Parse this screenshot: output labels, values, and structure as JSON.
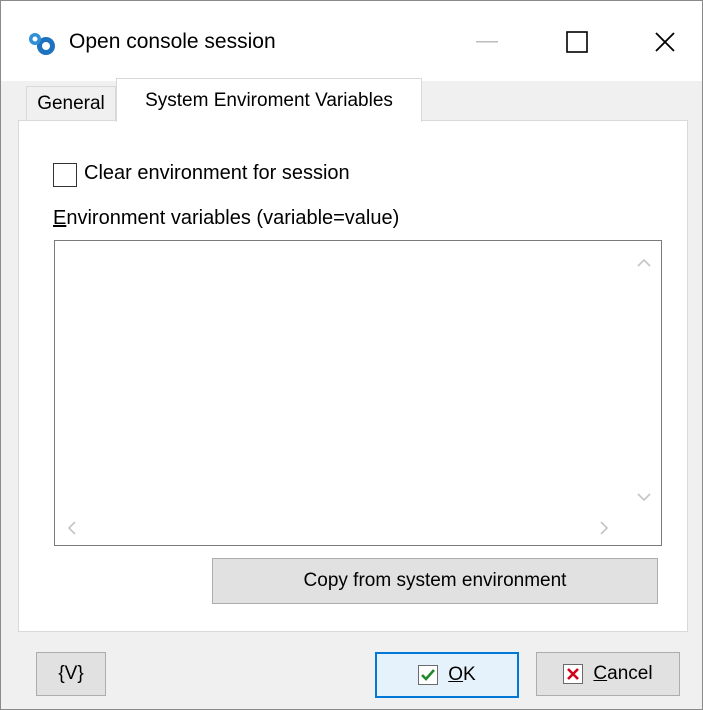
{
  "window": {
    "title": "Open console session",
    "minimize_icon": "minimize-icon",
    "maximize_icon": "maximize-icon",
    "close_icon": "close-icon"
  },
  "tabs": [
    {
      "label": "General",
      "selected": false
    },
    {
      "label": "System Enviroment Variables",
      "selected": true
    }
  ],
  "options": {
    "clear_env_label": "Clear environment for session",
    "clear_env_checked": false
  },
  "env_vars": {
    "label_first": "E",
    "label_rest": "nvironment variables (variable=value)",
    "value": ""
  },
  "buttons": {
    "copy_label": "Copy from system environment",
    "variables_label": "{V}",
    "ok_first": "O",
    "ok_rest": "K",
    "cancel_first": "C",
    "cancel_rest": "ancel"
  },
  "colors": {
    "accent": "#0078d7",
    "ok_check": "#1f8a2c",
    "cancel_x": "#d0021b"
  }
}
